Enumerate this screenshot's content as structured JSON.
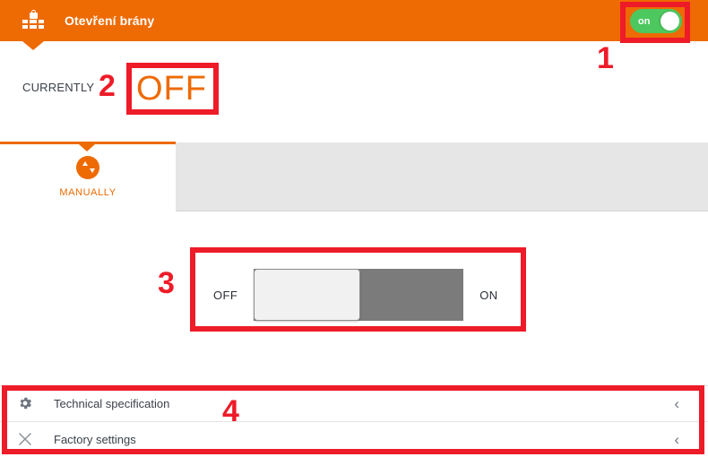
{
  "header": {
    "title": "Otevření brány",
    "icon": "gate-lock-icon",
    "background_color": "#ee6a02",
    "master_toggle": {
      "label": "on",
      "state": "on",
      "on_color": "#4cc85e"
    }
  },
  "status": {
    "label": "CURRENTLY",
    "value": "OFF",
    "value_color": "#ee6a02"
  },
  "tabs": [
    {
      "label": "MANUALLY",
      "icon": "up-down-arrows-icon",
      "active": true,
      "accent_color": "#ee6a02"
    }
  ],
  "slider": {
    "left_label": "OFF",
    "right_label": "ON",
    "position": "off",
    "track_color": "#7b7b7b",
    "knob_color": "#f1f1f1"
  },
  "bottom_list": {
    "items": [
      {
        "label": "Technical specification",
        "icon": "gear-icon",
        "chevron": "‹"
      },
      {
        "label": "Factory settings",
        "icon": "close-x-icon",
        "chevron": "‹"
      }
    ]
  },
  "annotations": {
    "color": "#ee1b28",
    "markers": [
      {
        "number": "1",
        "target": "master-toggle"
      },
      {
        "number": "2",
        "target": "currently-value"
      },
      {
        "number": "3",
        "target": "manual-slider"
      },
      {
        "number": "4",
        "target": "bottom-list"
      }
    ]
  }
}
